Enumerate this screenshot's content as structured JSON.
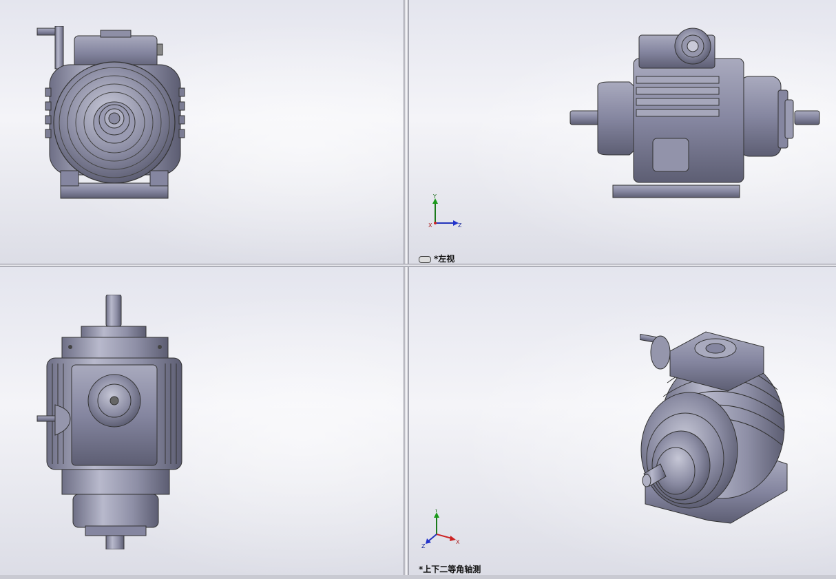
{
  "views": {
    "top_right": {
      "label": "*左视",
      "triad": {
        "axis_1": "Y",
        "axis_2": "Z",
        "axis_3": "X"
      }
    },
    "bottom_right": {
      "label": "*上下二等角轴测",
      "triad": {
        "axis_1": "Y",
        "axis_2": "X",
        "axis_3": "Z"
      }
    }
  },
  "colors": {
    "model_body": "#8e8fa6",
    "model_dark": "#4a4b5c",
    "model_light": "#c9cad8",
    "background_top": "#e4e5ee"
  }
}
